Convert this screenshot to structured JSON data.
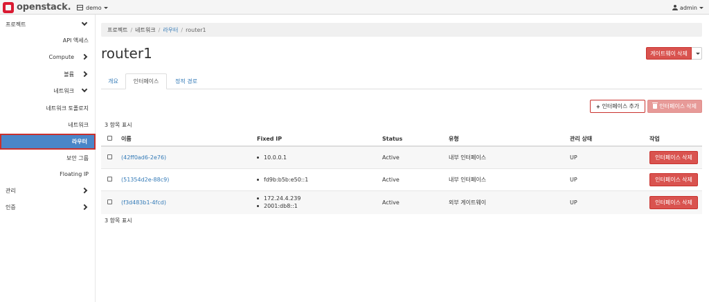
{
  "header": {
    "brand": "openstack.",
    "project": "demo",
    "user": "admin"
  },
  "sidebar": {
    "items": [
      {
        "label": "프로젝트",
        "level": 0,
        "chevron": "down"
      },
      {
        "label": "API 액세스",
        "level": 1
      },
      {
        "label": "Compute",
        "level": 1,
        "chevron": "right"
      },
      {
        "label": "볼륨",
        "level": 1,
        "chevron": "right"
      },
      {
        "label": "네트워크",
        "level": 1,
        "chevron": "down"
      },
      {
        "label": "네트워크 토폴로지",
        "level": 2
      },
      {
        "label": "네트워크",
        "level": 2
      },
      {
        "label": "라우터",
        "level": 2,
        "active": true
      },
      {
        "label": "보안 그룹",
        "level": 2
      },
      {
        "label": "Floating IP",
        "level": 2
      },
      {
        "label": "관리",
        "level": 0,
        "chevron": "right"
      },
      {
        "label": "인증",
        "level": 0,
        "chevron": "right"
      }
    ]
  },
  "breadcrumb": {
    "items": [
      "프로젝트",
      "네트워크",
      "라우터",
      "router1"
    ]
  },
  "page": {
    "title": "router1",
    "gateway_delete": "게이트웨이 삭제"
  },
  "tabs": [
    {
      "label": "개요"
    },
    {
      "label": "인터페이스",
      "active": true
    },
    {
      "label": "정적 경로"
    }
  ],
  "actions": {
    "add_interface": "인터페이스 추가",
    "delete_interfaces": "인터페이스 삭제"
  },
  "table": {
    "count_text": "3 항목 표시",
    "columns": [
      "이름",
      "Fixed IP",
      "Status",
      "유형",
      "관리 상태",
      "작업"
    ],
    "rows": [
      {
        "name": "(42ff0ad6-2e76)",
        "fixed_ips": [
          "10.0.0.1"
        ],
        "status": "Active",
        "type": "내부 인터페이스",
        "admin_state": "UP",
        "action": "인터페이스 삭제"
      },
      {
        "name": "(51354d2e-88c9)",
        "fixed_ips": [
          "fd9b:b5b:e50::1"
        ],
        "status": "Active",
        "type": "내부 인터페이스",
        "admin_state": "UP",
        "action": "인터페이스 삭제"
      },
      {
        "name": "(f3d483b1-4fcd)",
        "fixed_ips": [
          "172.24.4.239",
          "2001:db8::1"
        ],
        "status": "Active",
        "type": "외부 게이트웨이",
        "admin_state": "UP",
        "action": "인터페이스 삭제"
      }
    ]
  },
  "icons": {
    "brand": "openstack-logo-icon",
    "project": "project-icon",
    "user": "user-icon",
    "add": "plus-icon",
    "delete": "trash-icon"
  },
  "colors": {
    "danger": "#d9534f",
    "active_nav": "#4a86c8",
    "link": "#337ab7"
  }
}
